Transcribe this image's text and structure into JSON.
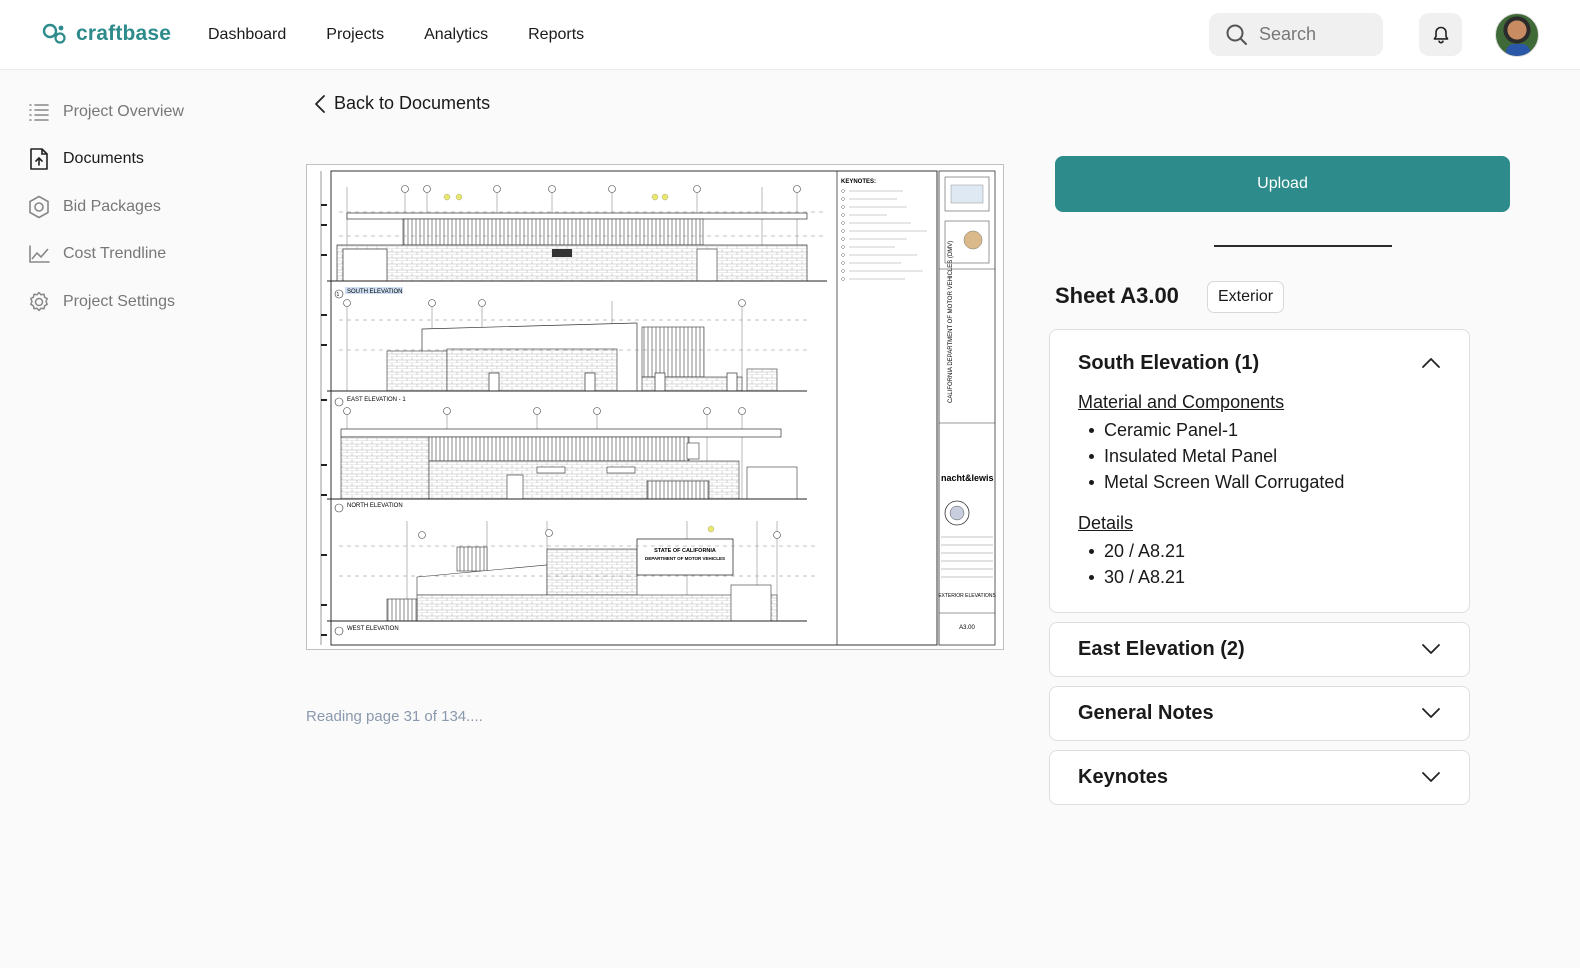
{
  "brand": {
    "name": "craftbase",
    "color": "#2e8b8b"
  },
  "nav": {
    "items": [
      "Dashboard",
      "Projects",
      "Analytics",
      "Reports"
    ]
  },
  "search": {
    "placeholder": "Search"
  },
  "sidebar": {
    "items": [
      {
        "label": "Project Overview",
        "icon": "list-icon",
        "active": false
      },
      {
        "label": "Documents",
        "icon": "document-upload-icon",
        "active": true
      },
      {
        "label": "Bid Packages",
        "icon": "hexagon-icon",
        "active": false
      },
      {
        "label": "Cost Trendline",
        "icon": "line-chart-icon",
        "active": false
      },
      {
        "label": "Project Settings",
        "icon": "gear-icon",
        "active": false
      }
    ]
  },
  "back_link": "Back to Documents",
  "document": {
    "reading_status": "Reading page 31 of 134....",
    "drawing": {
      "elevations": [
        "SOUTH ELEVATION",
        "EAST ELEVATION - 1",
        "NORTH ELEVATION",
        "WEST ELEVATION"
      ],
      "keynotes_title": "KEYNOTES:",
      "sign_text": [
        "STATE OF CALIFORNIA",
        "DEPARTMENT OF MOTOR VEHICLES"
      ],
      "title_block": {
        "project": "CALIFORNIA DEPARTMENT OF MOTOR VEHICLES (DMV)",
        "firm": "nacht&lewis",
        "sheet_title": "EXTERIOR ELEVATIONS",
        "sheet_no": "A3.00"
      }
    }
  },
  "panel": {
    "upload_label": "Upload",
    "sheet_title": "Sheet A3.00",
    "sheet_tag": "Exterior",
    "sections": [
      {
        "title": "South Elevation (1)",
        "expanded": true,
        "groups": [
          {
            "label": "Material and Components",
            "items": [
              "Ceramic Panel-1",
              "Insulated Metal Panel",
              "Metal Screen Wall Corrugated"
            ]
          },
          {
            "label": "Details",
            "items": [
              "20 / A8.21",
              "30 / A8.21"
            ]
          }
        ]
      },
      {
        "title": "East Elevation (2)",
        "expanded": false
      },
      {
        "title": "General Notes",
        "expanded": false
      },
      {
        "title": "Keynotes",
        "expanded": false
      }
    ]
  }
}
